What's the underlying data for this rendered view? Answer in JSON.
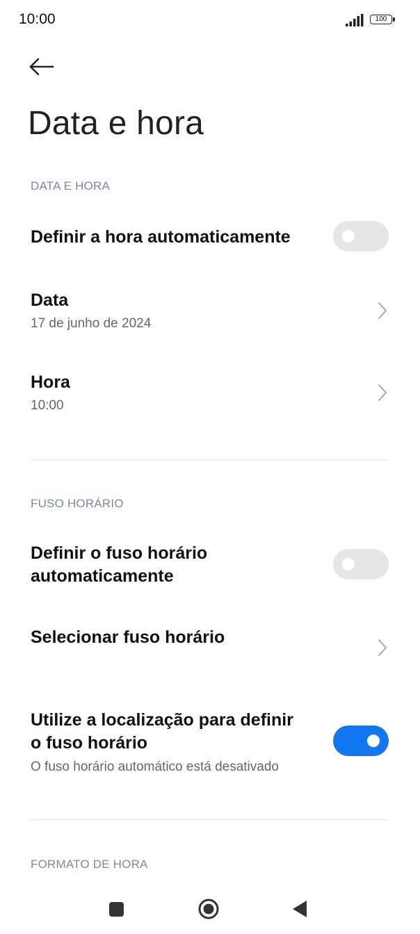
{
  "status_bar": {
    "time": "10:00",
    "battery_level": "100",
    "icons": [
      "signal-icon",
      "battery-icon"
    ]
  },
  "header": {
    "back_icon": "arrow-left-icon",
    "title": "Data e hora"
  },
  "sections": {
    "date_time": {
      "header": "DATA E HORA",
      "auto_time": {
        "label": "Definir a hora automaticamente",
        "enabled": false
      },
      "date": {
        "label": "Data",
        "value": "17 de junho de 2024"
      },
      "time": {
        "label": "Hora",
        "value": "10:00"
      }
    },
    "time_zone": {
      "header": "FUSO HORÁRIO",
      "auto_zone": {
        "label_line1": "Definir o fuso horário",
        "label_line2": "automaticamente",
        "enabled": false
      },
      "select_zone": {
        "label": "Selecionar fuso horário"
      },
      "use_location": {
        "label_line1": "Utilize a localização para definir",
        "label_line2": "o fuso horário",
        "subtitle": "O fuso horário automático está desativado",
        "enabled": true
      }
    },
    "time_format": {
      "header": "FORMATO DE HORA"
    }
  },
  "colors": {
    "toggle_on": "#1377ef",
    "toggle_off": "#e6e6e6",
    "section_header": "#7f86a0"
  },
  "nav_bar": {
    "icons": [
      "recents-square-icon",
      "home-circle-icon",
      "back-triangle-icon"
    ]
  }
}
